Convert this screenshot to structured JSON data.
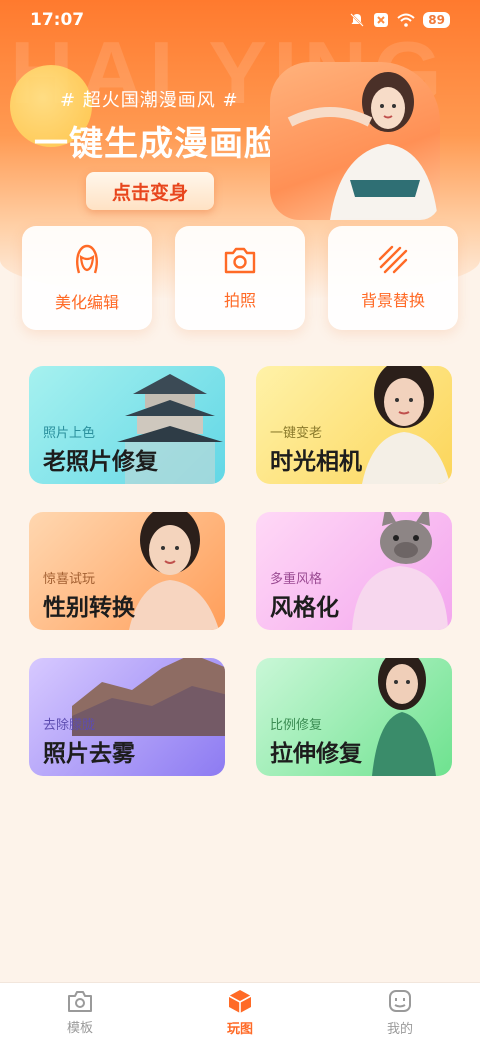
{
  "status_bar": {
    "time": "17:07",
    "battery": "89"
  },
  "banner": {
    "watermark": "HAI YING",
    "subtitle": "# 超火国潮漫画风 #",
    "title": "一键生成漫画脸",
    "cta": "点击变身"
  },
  "quick_tools": [
    {
      "label": "美化编辑",
      "icon": "face-outline-icon"
    },
    {
      "label": "拍照",
      "icon": "camera-icon"
    },
    {
      "label": "背景替换",
      "icon": "diagonal-stripes-icon"
    }
  ],
  "feature_cards": [
    {
      "tag": "照片上色",
      "name": "老照片修复",
      "art": "palace-tower-image"
    },
    {
      "tag": "一键变老",
      "name": "时光相机",
      "art": "woman-portrait-image"
    },
    {
      "tag": "惊喜试玩",
      "name": "性别转换",
      "art": "woman-portrait-image"
    },
    {
      "tag": "多重风格",
      "name": "风格化",
      "art": "french-bulldog-image"
    },
    {
      "tag": "去除朦胧",
      "name": "照片去雾",
      "art": "mountain-image"
    },
    {
      "tag": "比例修复",
      "name": "拉伸修复",
      "art": "woman-portrait-image"
    }
  ],
  "tab_bar": [
    {
      "label": "模板",
      "icon": "camera-outline-icon",
      "active": false
    },
    {
      "label": "玩图",
      "icon": "cube-icon",
      "active": true
    },
    {
      "label": "我的",
      "icon": "profile-face-icon",
      "active": false
    }
  ],
  "colors": {
    "accent": "#ff6a26",
    "hero_top": "#ff7a2e",
    "page_bg": "#fdf3ea"
  }
}
